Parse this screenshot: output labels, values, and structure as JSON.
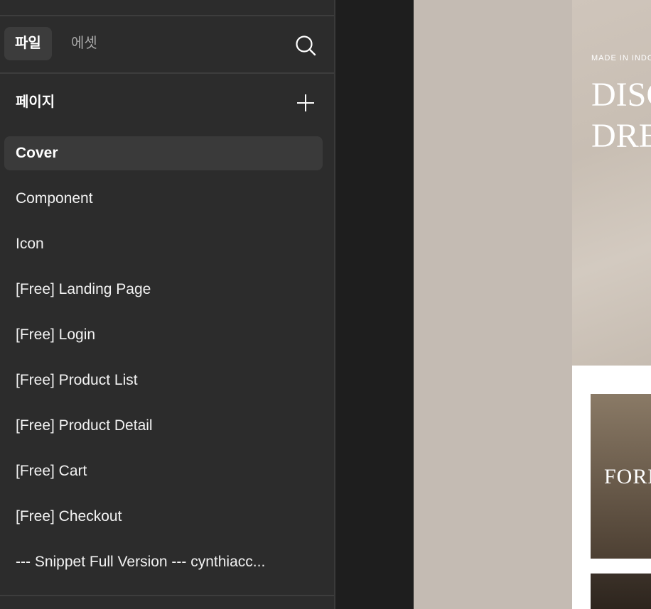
{
  "sidebar": {
    "tabs": [
      {
        "label": "파일",
        "active": true
      },
      {
        "label": "에셋",
        "active": false
      }
    ],
    "search_icon": "search-icon",
    "pages_title": "페이지",
    "add_icon": "plus-icon",
    "pages": [
      {
        "label": "Cover",
        "selected": true
      },
      {
        "label": "Component"
      },
      {
        "label": "Icon"
      },
      {
        "label": "[Free] Landing Page"
      },
      {
        "label": "[Free] Login"
      },
      {
        "label": "[Free] Product List"
      },
      {
        "label": "[Free] Product Detail"
      },
      {
        "label": "[Free] Cart"
      },
      {
        "label": "[Free] Checkout"
      },
      {
        "label": "--- Snippet Full Version --- cynthiacc..."
      }
    ]
  },
  "canvas": {
    "hero_kicker": "MADE IN INDO",
    "hero_title_line1": "DISC",
    "hero_title_line2": "DRE",
    "card_text": "FORM"
  },
  "colors": {
    "panel_bg": "#2c2c2c",
    "canvas_bg": "#c4bbb3",
    "selected_item_bg": "#3a3a3a"
  }
}
